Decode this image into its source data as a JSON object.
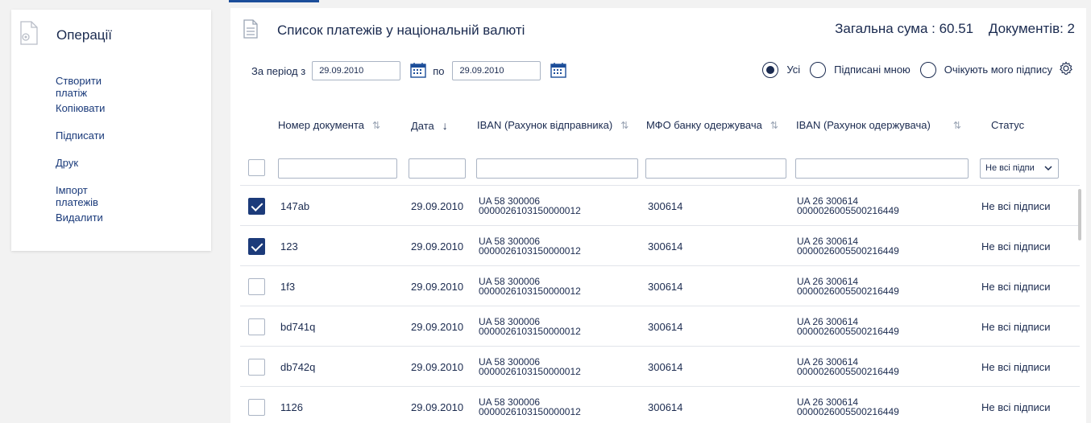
{
  "operations": {
    "title": "Операції",
    "icon": "document-gear-icon",
    "items": [
      {
        "label": "Створити платіж",
        "icon": "create-icon"
      },
      {
        "label": "Копіювати"
      },
      {
        "label": "Підписати"
      },
      {
        "label": "Друк"
      },
      {
        "label": "Імпорт платежів"
      },
      {
        "label": "Видалити"
      }
    ]
  },
  "header": {
    "title": "Список платежів у національній валюті",
    "total_label": "Загальна сума : 60.51",
    "docs_label": "Документів: 2"
  },
  "period": {
    "from_label": "За період з",
    "from_value": "29.09.2010",
    "to_label": "по",
    "to_value": "29.09.2010"
  },
  "filters": {
    "all": "Усі",
    "signed_by_me": "Підписані мною",
    "awaiting": "Очікують мого підпису",
    "selected": "all"
  },
  "columns": [
    {
      "label": "Номер документа"
    },
    {
      "label": "Дата"
    },
    {
      "label": "IBAN (Рахунок відправника)"
    },
    {
      "label": "МФО банку одержувача"
    },
    {
      "label": "IBAN (Рахунок одержувача)"
    },
    {
      "label": "Статус"
    }
  ],
  "status_filter": "Не всі підпи",
  "rows": [
    {
      "checked": true,
      "doc": "147ab",
      "date": "29.09.2010",
      "iban_from_1": "UA 58 300006",
      "iban_from_2": "0000026103150000012",
      "mfo": "300614",
      "iban_to_1": "UA 26 300614",
      "iban_to_2": "0000026005500216449",
      "status": "Не всі підписи"
    },
    {
      "checked": true,
      "doc": "123",
      "date": "29.09.2010",
      "iban_from_1": "UA 58 300006",
      "iban_from_2": "0000026103150000012",
      "mfo": "300614",
      "iban_to_1": "UA 26 300614",
      "iban_to_2": "0000026005500216449",
      "status": "Не всі підписи"
    },
    {
      "checked": false,
      "doc": "1f3",
      "date": "29.09.2010",
      "iban_from_1": "UA 58 300006",
      "iban_from_2": "0000026103150000012",
      "mfo": "300614",
      "iban_to_1": "UA 26 300614",
      "iban_to_2": "0000026005500216449",
      "status": "Не всі підписи"
    },
    {
      "checked": false,
      "doc": "bd741q",
      "date": "29.09.2010",
      "iban_from_1": "UA 58 300006",
      "iban_from_2": "0000026103150000012",
      "mfo": "300614",
      "iban_to_1": "UA 26 300614",
      "iban_to_2": "0000026005500216449",
      "status": "Не всі підписи"
    },
    {
      "checked": false,
      "doc": "db742q",
      "date": "29.09.2010",
      "iban_from_1": "UA 58 300006",
      "iban_from_2": "0000026103150000012",
      "mfo": "300614",
      "iban_to_1": "UA 26 300614",
      "iban_to_2": "0000026005500216449",
      "status": "Не всі підписи"
    },
    {
      "checked": false,
      "doc": "1126",
      "date": "29.09.2010",
      "iban_from_1": "UA 58 300006",
      "iban_from_2": "0000026103150000012",
      "mfo": "300614",
      "iban_to_1": "UA 26 300614",
      "iban_to_2": "0000026005500216449",
      "status": "Не всі підписи"
    }
  ]
}
